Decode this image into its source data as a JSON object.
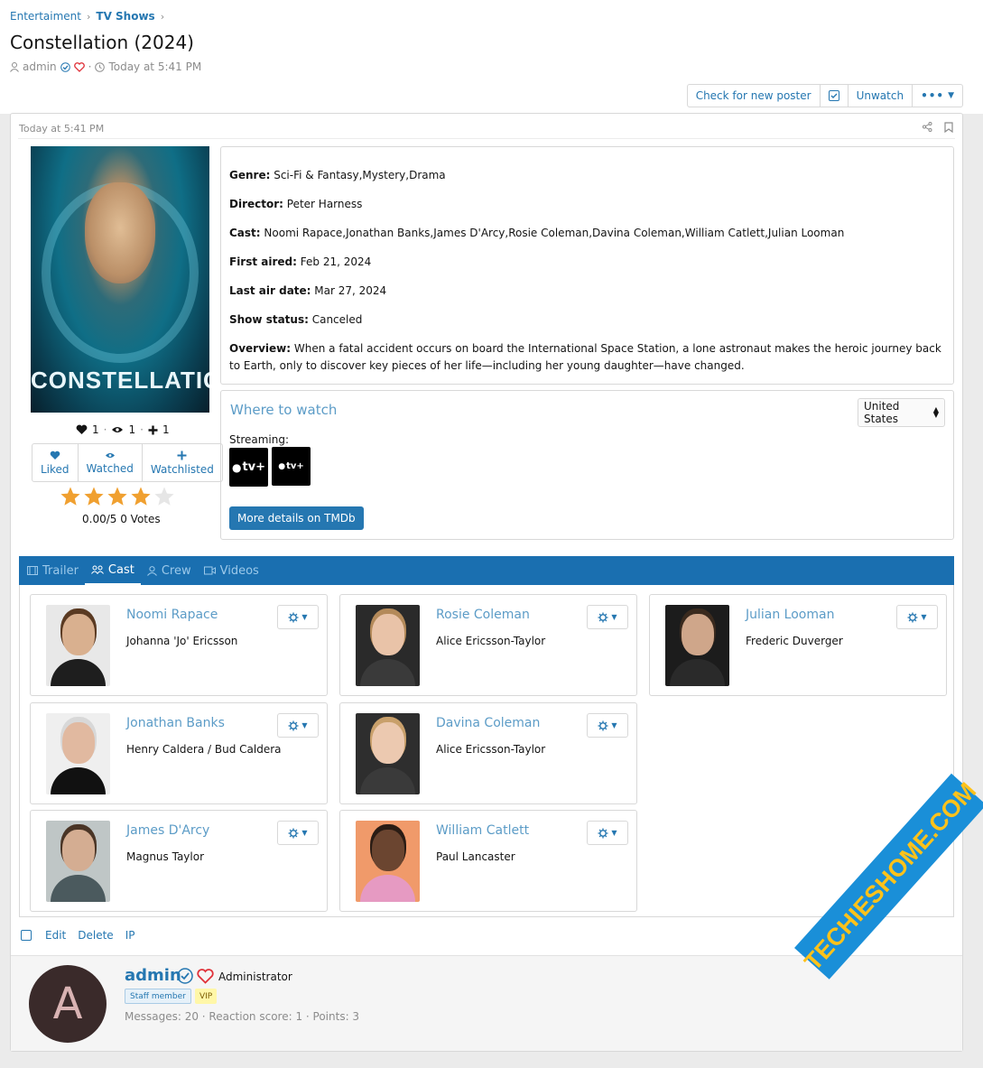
{
  "breadcrumb": {
    "items": [
      "Entertaiment",
      "TV Shows"
    ]
  },
  "page": {
    "title": "Constellation (2024)",
    "author": "admin",
    "date": "Today at 5:41 PM"
  },
  "toolbar": {
    "check_poster": "Check for new poster",
    "unwatch": "Unwatch"
  },
  "post": {
    "date": "Today at 5:41 PM",
    "poster_title": "CONSTELLATION"
  },
  "reactions": {
    "likes": "1",
    "watched": "1",
    "watchlisted": "1"
  },
  "reaction_buttons": {
    "liked": "Liked",
    "watched": "Watched",
    "watchlisted": "Watchlisted"
  },
  "rating": {
    "stars_filled": 4,
    "stars_total": 5,
    "text": "0.00/5 0 Votes"
  },
  "info": {
    "genre_label": "Genre:",
    "genre": "Sci-Fi & Fantasy,Mystery,Drama",
    "director_label": "Director:",
    "director": "Peter Harness",
    "cast_label": "Cast:",
    "cast": "Noomi Rapace,Jonathan Banks,James D'Arcy,Rosie Coleman,Davina Coleman,William Catlett,Julian Looman",
    "first_aired_label": "First aired:",
    "first_aired": "Feb 21, 2024",
    "last_air_label": "Last air date:",
    "last_air": "Mar 27, 2024",
    "status_label": "Show status:",
    "status": "Canceled",
    "overview_label": "Overview:",
    "overview": "When a fatal accident occurs on board the International Space Station, a lone astronaut makes the heroic journey back to Earth, only to discover key pieces of her life—including her young daughter—have changed."
  },
  "where_to_watch": {
    "title": "Where to watch",
    "country": "United States",
    "streaming_label": "Streaming:",
    "provider1": "tv+",
    "provider2": "tv+",
    "button": "More details on TMDb"
  },
  "tabs": [
    {
      "label": "Trailer"
    },
    {
      "label": "Cast"
    },
    {
      "label": "Crew"
    },
    {
      "label": "Videos"
    }
  ],
  "cast": [
    {
      "name": "Noomi Rapace",
      "role": "Johanna 'Jo' Ericsson",
      "skin": "#d9b08f",
      "hair": "#5a3a22",
      "cloth": "#1e1e1e",
      "bg": "#e8e8e8"
    },
    {
      "name": "Rosie Coleman",
      "role": "Alice Ericsson-Taylor",
      "skin": "#e9c3a8",
      "hair": "#b48a5a",
      "cloth": "#3a3a3a",
      "bg": "#2a2a2a"
    },
    {
      "name": "Julian Looman",
      "role": "Frederic Duverger",
      "skin": "#cfa68a",
      "hair": "#3a2a1e",
      "cloth": "#2a2a2a",
      "bg": "#1c1c1c"
    },
    {
      "name": "Jonathan Banks",
      "role": "Henry Caldera / Bud Caldera",
      "skin": "#e1b9a0",
      "hair": "#d8d8d8",
      "cloth": "#111111",
      "bg": "#efefef"
    },
    {
      "name": "Davina Coleman",
      "role": "Alice Ericsson-Taylor",
      "skin": "#ecc9b0",
      "hair": "#c9a06b",
      "cloth": "#3a3a3a",
      "bg": "#2e2e2e"
    },
    {
      "name": "James D'Arcy",
      "role": "Magnus Taylor",
      "skin": "#d4ad92",
      "hair": "#4a3526",
      "cloth": "#4b5a5e",
      "bg": "#bfc6c6"
    },
    {
      "name": "William Catlett",
      "role": "Paul Lancaster",
      "skin": "#6b4530",
      "hair": "#2a1c14",
      "cloth": "#e69ac2",
      "bg": "#f09a6a"
    }
  ],
  "post_actions": {
    "edit": "Edit",
    "delete": "Delete",
    "ip": "IP"
  },
  "user": {
    "avatar_letter": "A",
    "name": "admin",
    "title": "Administrator",
    "badge_staff": "Staff member",
    "badge_vip": "VIP",
    "stats": "Messages: 20 · Reaction score: 1 · Points: 3"
  },
  "watermark": "TECHIESHOME.COM",
  "colors": {
    "accent": "#2577b1",
    "tab_bar": "#1a6fb0",
    "star": "#f0a030",
    "link_light": "#5c9cc7"
  }
}
